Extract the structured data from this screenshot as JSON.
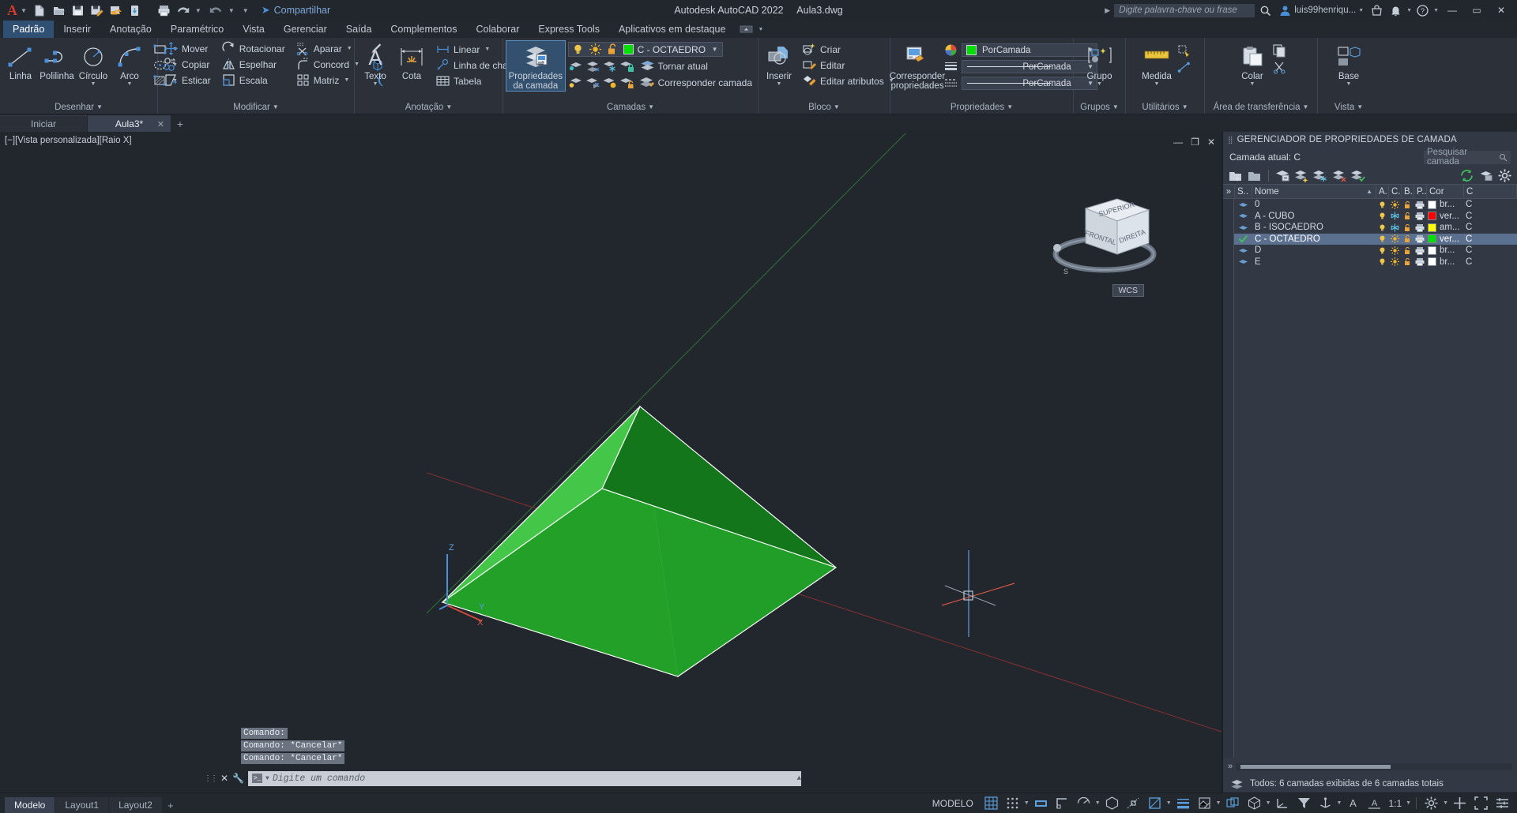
{
  "titlebar": {
    "app_title": "Autodesk AutoCAD 2022",
    "file_name": "Aula3.dwg",
    "share_label": "Compartilhar",
    "quick_access": [
      {
        "name": "new-file-icon",
        "tip": "Novo"
      },
      {
        "name": "open-file-icon",
        "tip": "Abrir"
      },
      {
        "name": "save-icon",
        "tip": "Salvar"
      },
      {
        "name": "save-as-icon",
        "tip": "Salvar como"
      },
      {
        "name": "export-icon",
        "tip": "Exportar"
      },
      {
        "name": "cloud-sync-icon",
        "tip": "Sincronizar"
      },
      {
        "name": "plot-icon",
        "tip": "Plotar"
      },
      {
        "name": "undo-icon",
        "tip": "Desfazer"
      },
      {
        "name": "redo-icon",
        "tip": "Refazer"
      }
    ],
    "search_placeholder": "Digite palavra-chave ou frase",
    "user_name": "luis99henriqu...",
    "window_min": "—",
    "window_max": "▭",
    "window_close": "✕"
  },
  "menu": {
    "tabs": [
      {
        "label": "Padrão",
        "active": true
      },
      {
        "label": "Inserir",
        "active": false
      },
      {
        "label": "Anotação",
        "active": false
      },
      {
        "label": "Paramétrico",
        "active": false
      },
      {
        "label": "Vista",
        "active": false
      },
      {
        "label": "Gerenciar",
        "active": false
      },
      {
        "label": "Saída",
        "active": false
      },
      {
        "label": "Complementos",
        "active": false
      },
      {
        "label": "Colaborar",
        "active": false
      },
      {
        "label": "Express Tools",
        "active": false
      },
      {
        "label": "Aplicativos em destaque",
        "active": false
      }
    ]
  },
  "ribbon": {
    "panels": [
      {
        "title": "Desenhar",
        "big": [
          {
            "label": "Linha",
            "icon": "line-icon",
            "dropdown": false
          },
          {
            "label": "Polilinha",
            "icon": "polyline-icon",
            "dropdown": false
          },
          {
            "label": "Círculo",
            "icon": "circle-icon",
            "dropdown": true
          },
          {
            "label": "Arco",
            "icon": "arc-icon",
            "dropdown": true
          }
        ],
        "small": [
          {
            "label": "",
            "icon": "rectangle-icon",
            "dropdown": true
          },
          {
            "label": "",
            "icon": "ellipse-icon",
            "dropdown": true
          },
          {
            "label": "",
            "icon": "hatch-icon",
            "dropdown": true
          }
        ]
      },
      {
        "title": "Modificar",
        "cols": [
          [
            {
              "label": "Mover",
              "icon": "move-icon"
            },
            {
              "label": "Copiar",
              "icon": "copy-icon"
            },
            {
              "label": "Esticar",
              "icon": "stretch-icon"
            }
          ],
          [
            {
              "label": "Rotacionar",
              "icon": "rotate-icon"
            },
            {
              "label": "Espelhar",
              "icon": "mirror-icon"
            },
            {
              "label": "Escala",
              "icon": "scale-icon"
            }
          ],
          [
            {
              "label": "Aparar",
              "icon": "trim-icon",
              "dropdown": true
            },
            {
              "label": "Concord",
              "icon": "fillet-icon",
              "dropdown": true
            },
            {
              "label": "Matriz",
              "icon": "array-icon",
              "dropdown": true
            }
          ],
          [
            {
              "label": "",
              "icon": "erase-brush-icon"
            },
            {
              "label": "",
              "icon": "solid-edit-icon"
            },
            {
              "label": "",
              "icon": "offset-icon"
            }
          ]
        ]
      },
      {
        "title": "Anotação",
        "big": [
          {
            "label": "Texto",
            "icon": "text-icon",
            "dropdown": true
          },
          {
            "label": "Cota",
            "icon": "dimension-icon",
            "dropdown": false
          }
        ],
        "small": [
          {
            "label": "Linear",
            "icon": "linear-dim-icon",
            "dropdown": true
          },
          {
            "label": "Linha de chamada",
            "icon": "leader-icon",
            "dropdown": true
          },
          {
            "label": "Tabela",
            "icon": "table-icon",
            "dropdown": false
          }
        ]
      },
      {
        "title": "Camadas",
        "big": [
          {
            "label": "Propriedades\nda camada",
            "icon": "layer-properties-icon",
            "active": true
          }
        ],
        "current_layer": "C - OCTAEDRO",
        "current_layer_color": "#00e000",
        "state_icons": [
          "lightbulb-on-icon",
          "sun-icon",
          "unlock-icon"
        ],
        "rows": [
          {
            "label": "Tornar atual",
            "icon": "make-current-icon"
          },
          {
            "label": "Corresponder camada",
            "icon": "match-layer-icon"
          }
        ],
        "tool_icons_row1": [
          "layer-isolate-icon",
          "layer-off-icon",
          "layer-freeze-icon",
          "layer-lock-icon"
        ],
        "tool_icons_row2": [
          "layer-unisolate-icon",
          "layer-on-icon",
          "layer-thaw-icon",
          "layer-unlock-icon"
        ]
      },
      {
        "title": "Bloco",
        "big": [
          {
            "label": "Inserir",
            "icon": "insert-block-icon",
            "dropdown": true
          }
        ],
        "rows": [
          {
            "label": "Criar",
            "icon": "create-block-icon"
          },
          {
            "label": "Editar",
            "icon": "edit-block-icon"
          },
          {
            "label": "Editar atributos",
            "icon": "edit-attributes-icon",
            "dropdown": true
          }
        ]
      },
      {
        "title": "Propriedades",
        "big": [
          {
            "label": "Corresponder\npropriedades",
            "icon": "match-properties-icon"
          }
        ],
        "props": [
          {
            "icon": "color-wheel-icon",
            "value": "PorCamada",
            "swatch": "#00e000",
            "type": "color"
          },
          {
            "icon": "linewidth-icon",
            "value": "PorCamada",
            "type": "line"
          },
          {
            "icon": "linetype-icon",
            "value": "PorCamada",
            "type": "line"
          }
        ]
      },
      {
        "title": "Grupos",
        "big": [
          {
            "label": "Grupo",
            "icon": "group-icon",
            "dropdown": true
          }
        ]
      },
      {
        "title": "Utilitários",
        "big": [
          {
            "label": "Medida",
            "icon": "measure-icon",
            "dropdown": true
          }
        ]
      },
      {
        "title": "Área de transferência",
        "big": [
          {
            "label": "Colar",
            "icon": "paste-icon",
            "dropdown": true
          }
        ]
      },
      {
        "title": "Vista",
        "big": [
          {
            "label": "Base",
            "icon": "base-view-icon",
            "dropdown": true
          }
        ]
      }
    ]
  },
  "file_tabs": {
    "tabs": [
      {
        "label": "Iniciar",
        "active": false,
        "closable": false
      },
      {
        "label": "Aula3*",
        "active": true,
        "closable": true
      }
    ],
    "add_label": "+"
  },
  "canvas": {
    "view_label": "[−][Vista personalizada][Raio X]",
    "viewcube": {
      "top": "SUPERIOR",
      "front": "FRONTAL",
      "right": "DIREITA",
      "wcs": "WCS"
    },
    "ucs_axes": {
      "x": "X",
      "y": "Y",
      "z": "Z"
    },
    "window_controls": [
      "minimize",
      "restore",
      "close"
    ],
    "shape": {
      "name": "octahedron-pyramid",
      "fill_light": "#3bb23b",
      "fill_mid": "#1d9a26",
      "fill_dark": "#0f7a18",
      "edge": "#ffffff"
    },
    "grid_axes": {
      "green": "#2e7d32",
      "red": "#7a2f2f"
    }
  },
  "command": {
    "history": [
      "Comando:",
      "Comando: *Cancelar*",
      "Comando: *Cancelar*"
    ],
    "input_placeholder": "Digite um comando"
  },
  "layer_panel": {
    "title": "GERENCIADOR DE PROPRIEDADES DE CAMADA",
    "current_layer_label": "Camada atual: C",
    "search_placeholder": "Pesquisar camada",
    "toolbar_icons": [
      "new-layer-icon",
      "new-layer-vp-icon",
      "delete-layer-icon",
      "set-current-icon",
      "layer-state-new-icon",
      "layer-freeze-all-icon",
      "layer-off-all-icon",
      "layer-check-icon"
    ],
    "right_icons": [
      "refresh-icon",
      "layer-settings-panel-icon",
      "settings-gear-icon"
    ],
    "columns": [
      "»",
      "S..",
      "Nome",
      "A.",
      "C.",
      "B..",
      "P..",
      "Cor",
      "C"
    ],
    "rows": [
      {
        "status": "layer",
        "name": "0",
        "on": true,
        "freeze": "sun",
        "lock": "unlocked",
        "plot": true,
        "color_swatch": "#ffffff",
        "color_name": "br...",
        "extra": "C"
      },
      {
        "status": "layer",
        "name": "A - CUBO",
        "on": true,
        "freeze": "snow",
        "lock": "unlocked",
        "plot": true,
        "color_swatch": "#ff0000",
        "color_name": "ver...",
        "extra": "C"
      },
      {
        "status": "layer",
        "name": "B - ISOCAEDRO",
        "on": true,
        "freeze": "snow",
        "lock": "unlocked",
        "plot": true,
        "color_swatch": "#ffff00",
        "color_name": "am...",
        "extra": "C"
      },
      {
        "status": "current",
        "name": "C - OCTAEDRO",
        "on": true,
        "freeze": "sun",
        "lock": "unlocked",
        "plot": true,
        "color_swatch": "#00e000",
        "color_name": "ver...",
        "extra": "C",
        "selected": true
      },
      {
        "status": "layer",
        "name": "D",
        "on": true,
        "freeze": "sun",
        "lock": "unlocked",
        "plot": true,
        "color_swatch": "#ffffff",
        "color_name": "br...",
        "extra": "C"
      },
      {
        "status": "layer",
        "name": "E",
        "on": true,
        "freeze": "sun",
        "lock": "unlocked",
        "plot": true,
        "color_swatch": "#ffffff",
        "color_name": "br...",
        "extra": "C"
      }
    ],
    "status_text": "Todos: 6 camadas exibidas de 6 camadas totais",
    "expand_chevrons": "»"
  },
  "statusbar": {
    "layout_tabs": [
      {
        "label": "Modelo",
        "active": true
      },
      {
        "label": "Layout1",
        "active": false
      },
      {
        "label": "Layout2",
        "active": false
      }
    ],
    "add_layout": "+",
    "model_label": "MODELO",
    "scale": "1:1",
    "right_icons": [
      "grid-display-icon",
      "snap-mode-icon",
      "infer-constraints-icon",
      "ortho-mode-icon",
      "polar-tracking-icon",
      "isometric-draft-icon",
      "object-snap-tracking-icon",
      "object-snap-icon",
      "lineweight-icon",
      "transparency-icon",
      "selection-cycling-icon",
      "3d-osnap-icon",
      "dynamic-ucs-icon",
      "selection-filter-icon",
      "gizmo-icon",
      "annotation-visibility-icon",
      "annotation-scale-icon",
      "workspace-gear-icon",
      "hardware-accel-icon",
      "fullscreen-icon",
      "customization-icon"
    ]
  }
}
